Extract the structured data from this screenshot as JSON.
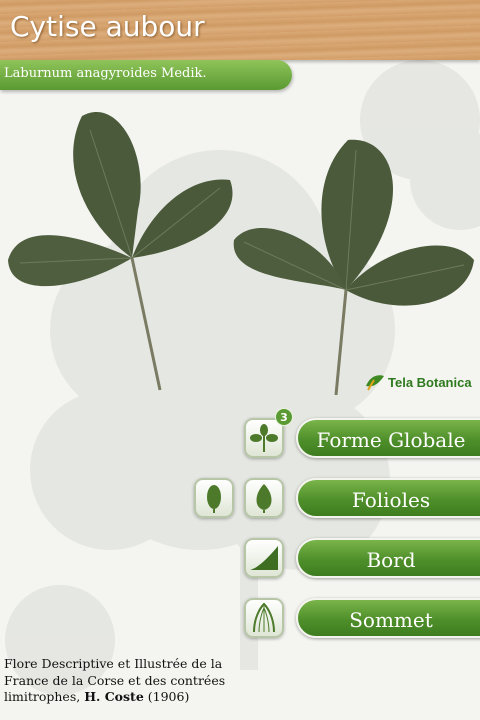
{
  "header": {
    "title": "Cytise aubour",
    "subtitle": "Laburnum anagyroides Medik."
  },
  "logo": {
    "text": "Tela Botanica"
  },
  "menu": {
    "items": [
      {
        "label": "Forme Globale",
        "badge": "3"
      },
      {
        "label": "Folioles"
      },
      {
        "label": "Bord"
      },
      {
        "label": "Sommet"
      }
    ]
  },
  "credit": {
    "text": "Flore Descriptive et Illustrée de la France de la Corse et des contrées limitrophes,",
    "author": "H. Coste",
    "year": "(1906)"
  },
  "colors": {
    "accent_green": "#5a9a32",
    "leaf_green": "#4b5a3b",
    "wood": "#d6a36e"
  },
  "icons": [
    "leaf-shape-icon",
    "oval-leaflet-icon",
    "ovate-leaflet-icon",
    "leaf-margin-icon",
    "leaf-apex-icon",
    "tela-botanica-logo-icon"
  ]
}
